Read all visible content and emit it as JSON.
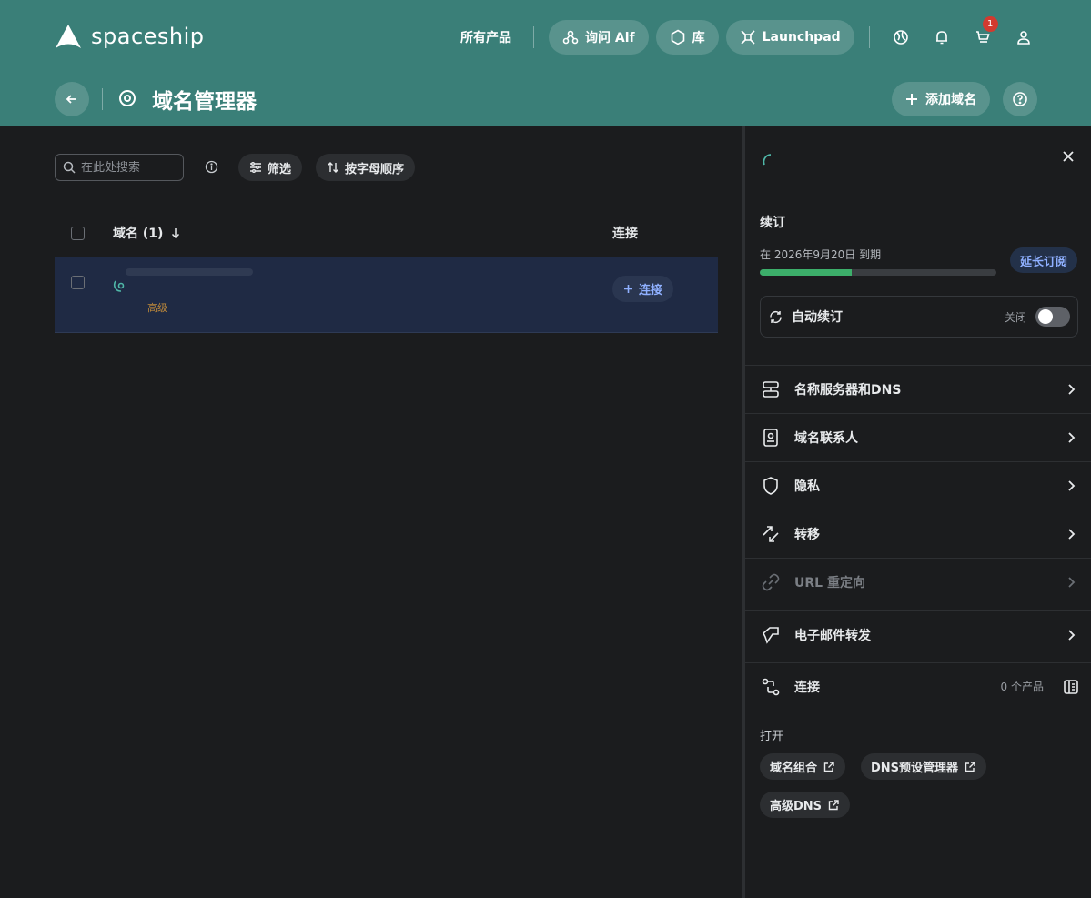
{
  "brand": {
    "name": "spaceship"
  },
  "nav": {
    "all_products": "所有产品",
    "ask_alf": "询问 Alf",
    "library": "库",
    "launchpad": "Launchpad",
    "cart_count": "1"
  },
  "page": {
    "title": "域名管理器",
    "add_domain": "添加域名"
  },
  "toolbar": {
    "search_placeholder": "在此处搜索",
    "filter": "筛选",
    "sort": "按字母顺序"
  },
  "table": {
    "col_domain": "域名 (1)",
    "col_connect": "连接",
    "rows": [
      {
        "tag": "高级",
        "connect_label": "连接"
      }
    ]
  },
  "panel": {
    "renewal_title": "续订",
    "expiry_text": "在 2026年9月20日 到期",
    "renewal_progress": 0.39,
    "extend_label": "延长订阅",
    "auto_renew_label": "自动续订",
    "auto_renew_state": "关闭",
    "menu": {
      "nameservers": "名称服务器和DNS",
      "contacts": "域名联系人",
      "privacy": "隐私",
      "transfer": "转移",
      "url_redirect": "URL 重定向",
      "email_forward": "电子邮件转发",
      "connect": "连接",
      "connect_count": "0 个产品"
    },
    "open_label": "打开",
    "open_links": {
      "portfolio": "域名组合",
      "dns_presets": "DNS预设管理器",
      "advanced_dns": "高级DNS"
    }
  },
  "colors": {
    "header_bg": "#3a7f78",
    "page_bg": "#1b1c1e",
    "selected_row": "#1f2a44",
    "accent_link": "#8fb0ff",
    "progress": "#3cae6a",
    "badge": "#d23a2f"
  }
}
